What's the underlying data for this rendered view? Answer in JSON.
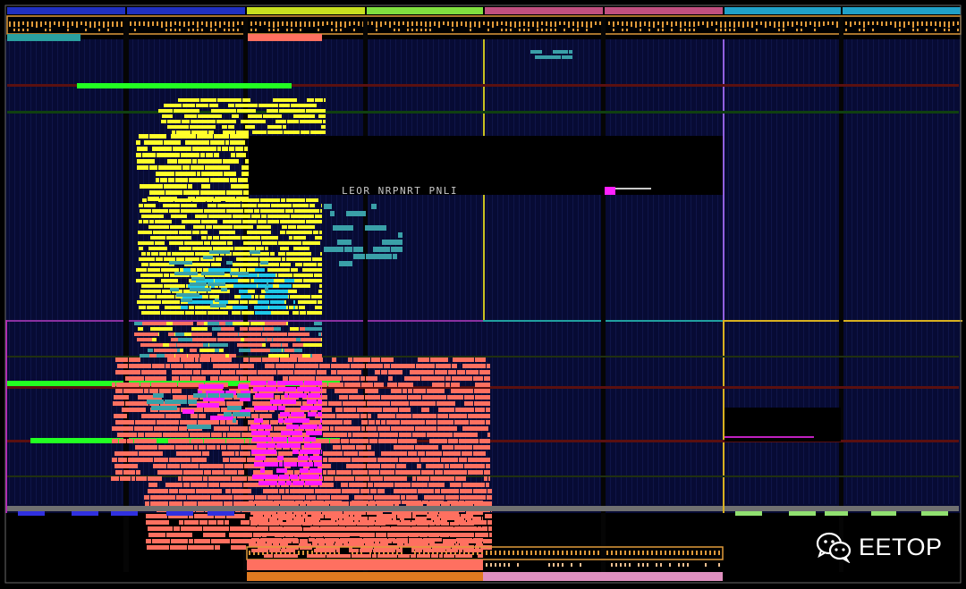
{
  "watermark": {
    "brand_text": "EETOP",
    "icon": "wechat-icon"
  },
  "canvas_text": {
    "center_label": "LEOR NRPNRT PNLI"
  },
  "colors": {
    "background": "#000000",
    "core_fill": "#070b34",
    "yellow_cells": "#ffff2a",
    "salmon_cells": "#ff7060",
    "green_cells": "#22ff22",
    "magenta_cells": "#ff1aff",
    "cyan_cells": "#1ec8e8",
    "teal_cells": "#3aa0a8",
    "blue_macro": "#2233cc",
    "light_green_macro": "#90e070",
    "orange_io": "#e09a3a",
    "partition_yellow": "#d8d020",
    "partition_purple": "#a060ff",
    "partition_magenta": "#d020d0",
    "partition_teal": "#20a0a0"
  }
}
